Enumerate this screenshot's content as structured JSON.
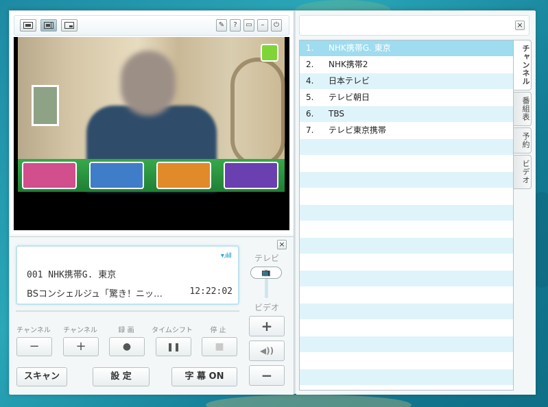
{
  "viewer": {
    "toolbar": {
      "layout_buttons": [
        "layout-single",
        "layout-split",
        "layout-mini"
      ],
      "right_buttons": [
        {
          "name": "tool-icon",
          "glyph": "✎"
        },
        {
          "name": "help-icon",
          "glyph": "?"
        },
        {
          "name": "window-icon",
          "glyph": "▭"
        },
        {
          "name": "minimize-icon",
          "glyph": "–"
        },
        {
          "name": "power-icon",
          "glyph": "⏻"
        }
      ]
    }
  },
  "info": {
    "channel_line": "001 NHK携帯G. 東京",
    "program_line": "BSコンシェルジュ「驚き！ニッ…",
    "time": "12:22:02",
    "signal": "▾.ılıll"
  },
  "controls": {
    "labels": [
      "チャンネル",
      "チャンネル",
      "録 画",
      "タイムシフト",
      "停 止"
    ],
    "buttons": [
      "−",
      "+",
      "●",
      "❚❚",
      "■"
    ],
    "scan": "スキャン",
    "settings": "設 定",
    "subtitle": "字 幕 ON",
    "close": "×"
  },
  "switch": {
    "tv_label": "テレビ",
    "video_label": "ビデオ",
    "tv_icon": "📺",
    "plus": "+",
    "volume": "◀))",
    "minus": "−"
  },
  "right": {
    "search_close": "×",
    "channels": [
      {
        "num": "1.",
        "name": "NHK携帯G. 東京"
      },
      {
        "num": "2.",
        "name": "NHK携帯2"
      },
      {
        "num": "4.",
        "name": "日本テレビ"
      },
      {
        "num": "5.",
        "name": "テレビ朝日"
      },
      {
        "num": "6.",
        "name": "TBS"
      },
      {
        "num": "7.",
        "name": "テレビ東京携帯"
      }
    ],
    "tabs": [
      "チャンネル",
      "番組表",
      "予約",
      "ビデオ"
    ]
  }
}
